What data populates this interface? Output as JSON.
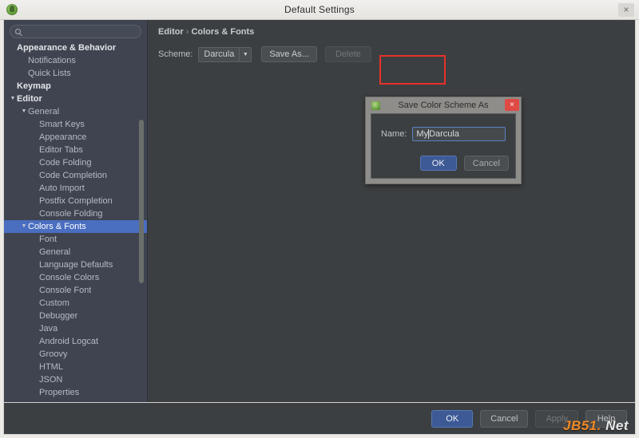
{
  "window": {
    "title": "Default Settings",
    "close_label": "×",
    "app_icon": "android-studio-icon"
  },
  "sidebar": {
    "search": {
      "placeholder": "",
      "icon": "search-icon"
    },
    "items": [
      {
        "label": "Appearance & Behavior",
        "indent": 1,
        "bold": true,
        "twisty": "",
        "selected": false
      },
      {
        "label": "Notifications",
        "indent": 2,
        "bold": false,
        "twisty": "",
        "selected": false
      },
      {
        "label": "Quick Lists",
        "indent": 2,
        "bold": false,
        "twisty": "",
        "selected": false
      },
      {
        "label": "Keymap",
        "indent": 1,
        "bold": true,
        "twisty": "",
        "selected": false
      },
      {
        "label": "Editor",
        "indent": 1,
        "bold": true,
        "twisty": "▼",
        "selected": false
      },
      {
        "label": "General",
        "indent": 2,
        "bold": false,
        "twisty": "▼",
        "selected": false
      },
      {
        "label": "Smart Keys",
        "indent": 3,
        "bold": false,
        "twisty": "",
        "selected": false
      },
      {
        "label": "Appearance",
        "indent": 3,
        "bold": false,
        "twisty": "",
        "selected": false
      },
      {
        "label": "Editor Tabs",
        "indent": 3,
        "bold": false,
        "twisty": "",
        "selected": false
      },
      {
        "label": "Code Folding",
        "indent": 3,
        "bold": false,
        "twisty": "",
        "selected": false
      },
      {
        "label": "Code Completion",
        "indent": 3,
        "bold": false,
        "twisty": "",
        "selected": false
      },
      {
        "label": "Auto Import",
        "indent": 3,
        "bold": false,
        "twisty": "",
        "selected": false
      },
      {
        "label": "Postfix Completion",
        "indent": 3,
        "bold": false,
        "twisty": "",
        "selected": false
      },
      {
        "label": "Console Folding",
        "indent": 3,
        "bold": false,
        "twisty": "",
        "selected": false
      },
      {
        "label": "Colors & Fonts",
        "indent": 2,
        "bold": false,
        "twisty": "▼",
        "selected": true
      },
      {
        "label": "Font",
        "indent": 3,
        "bold": false,
        "twisty": "",
        "selected": false
      },
      {
        "label": "General",
        "indent": 3,
        "bold": false,
        "twisty": "",
        "selected": false
      },
      {
        "label": "Language Defaults",
        "indent": 3,
        "bold": false,
        "twisty": "",
        "selected": false
      },
      {
        "label": "Console Colors",
        "indent": 3,
        "bold": false,
        "twisty": "",
        "selected": false
      },
      {
        "label": "Console Font",
        "indent": 3,
        "bold": false,
        "twisty": "",
        "selected": false
      },
      {
        "label": "Custom",
        "indent": 3,
        "bold": false,
        "twisty": "",
        "selected": false
      },
      {
        "label": "Debugger",
        "indent": 3,
        "bold": false,
        "twisty": "",
        "selected": false
      },
      {
        "label": "Java",
        "indent": 3,
        "bold": false,
        "twisty": "",
        "selected": false
      },
      {
        "label": "Android Logcat",
        "indent": 3,
        "bold": false,
        "twisty": "",
        "selected": false
      },
      {
        "label": "Groovy",
        "indent": 3,
        "bold": false,
        "twisty": "",
        "selected": false
      },
      {
        "label": "HTML",
        "indent": 3,
        "bold": false,
        "twisty": "",
        "selected": false
      },
      {
        "label": "JSON",
        "indent": 3,
        "bold": false,
        "twisty": "",
        "selected": false
      },
      {
        "label": "Properties",
        "indent": 3,
        "bold": false,
        "twisty": "",
        "selected": false
      }
    ]
  },
  "main": {
    "breadcrumb": {
      "root": "Editor",
      "separator": "›",
      "leaf": "Colors & Fonts"
    },
    "scheme": {
      "label": "Scheme:",
      "value": "Darcula",
      "arrow": "▼",
      "save_as_label": "Save As...",
      "delete_label": "Delete"
    },
    "highlight_color": "#e8312a"
  },
  "dialog": {
    "title": "Save Color Scheme As",
    "close_label": "×",
    "name_label": "Name:",
    "name_value_before_caret": "My",
    "name_value_after_caret": "Darcula",
    "name_value": "MyDarcula",
    "ok_label": "OK",
    "cancel_label": "Cancel"
  },
  "footer": {
    "ok_label": "OK",
    "cancel_label": "Cancel",
    "apply_label": "Apply",
    "help_label": "Help",
    "watermark_a": "JB51.",
    "watermark_b": " Net"
  }
}
